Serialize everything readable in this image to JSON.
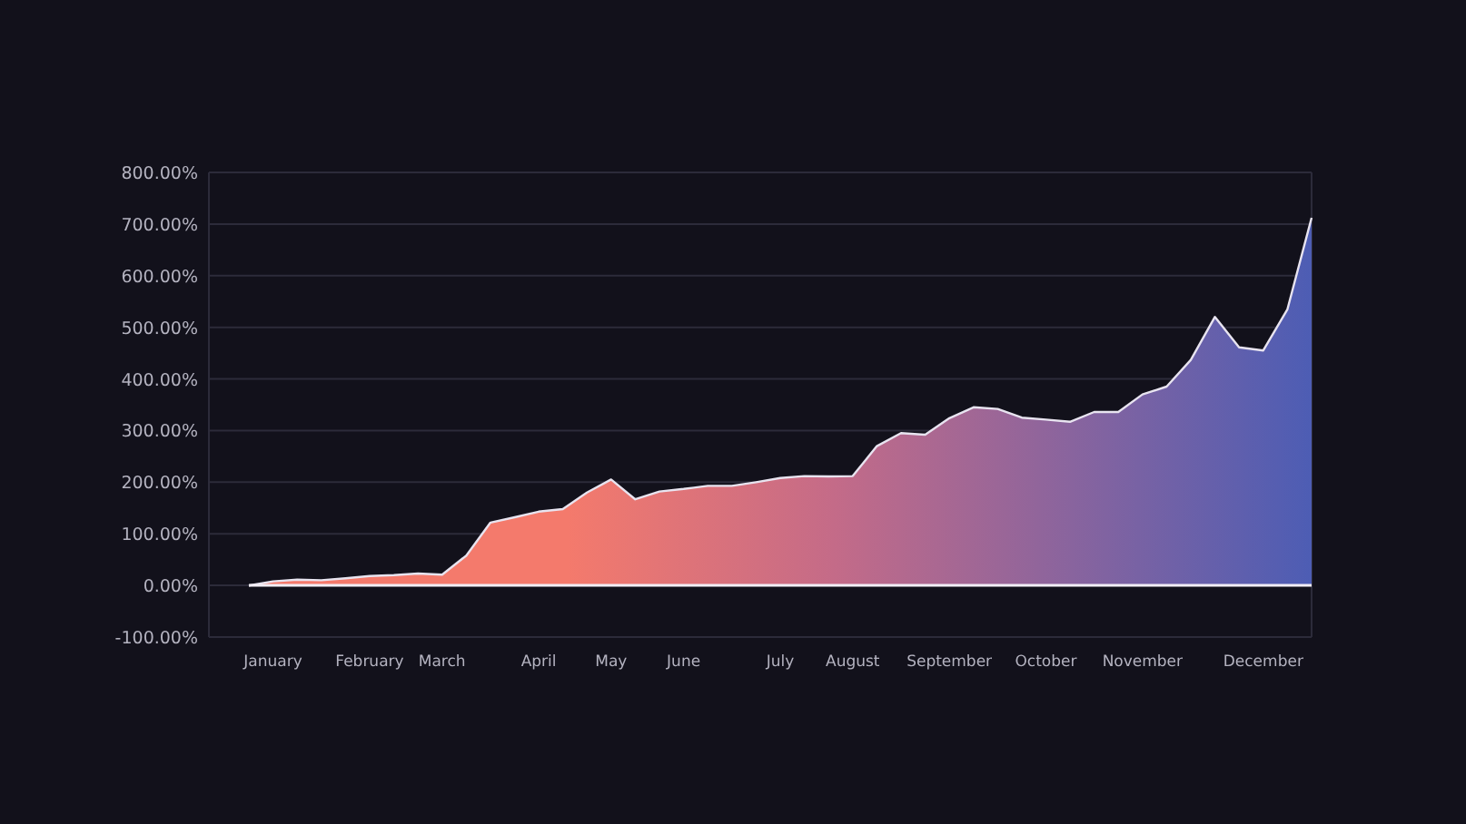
{
  "chart_data": {
    "type": "area",
    "grid": true,
    "categories": [
      null,
      "January",
      null,
      null,
      null,
      "February",
      null,
      null,
      "March",
      null,
      null,
      null,
      "April",
      null,
      null,
      "May",
      null,
      null,
      "June",
      null,
      null,
      null,
      "July",
      null,
      null,
      "August",
      null,
      null,
      null,
      "September",
      null,
      null,
      null,
      "October",
      null,
      null,
      null,
      "November",
      null,
      null,
      null,
      null,
      "December",
      null,
      null
    ],
    "series": [
      {
        "color": "#f47a6c",
        "values": [
          0,
          8,
          11,
          10,
          14,
          18,
          20,
          23,
          21,
          58,
          122,
          132,
          143,
          148,
          180,
          205,
          167,
          182,
          187,
          193,
          193,
          200,
          208,
          212,
          211,
          212,
          270,
          295,
          292,
          324,
          345,
          342,
          325,
          321,
          317,
          336,
          336,
          370,
          385,
          437,
          520,
          461,
          455,
          535,
          712
        ]
      }
    ],
    "ylim": [
      -100,
      800
    ],
    "yticks": [
      {
        "value": 800,
        "label": "800.00%"
      },
      {
        "value": 700,
        "label": "700.00%"
      },
      {
        "value": 600,
        "label": "600.00%"
      },
      {
        "value": 500,
        "label": "500.00%"
      },
      {
        "value": 400,
        "label": "400.00%"
      },
      {
        "value": 300,
        "label": "300.00%"
      },
      {
        "value": 200,
        "label": "200.00%"
      },
      {
        "value": 100,
        "label": "100.00%"
      },
      {
        "value": 0,
        "label": "0.00%"
      },
      {
        "value": -100,
        "label": "-100.00%"
      }
    ]
  }
}
